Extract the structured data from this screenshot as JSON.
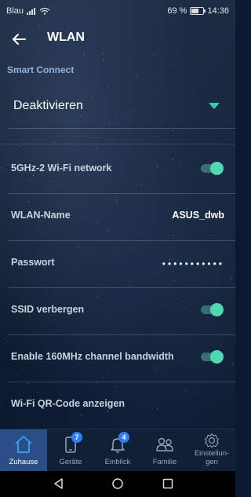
{
  "status_bar": {
    "carrier": "Blau",
    "battery": "69 %",
    "time": "14:36"
  },
  "header": {
    "title": "WLAN"
  },
  "section": {
    "label": "Smart Connect"
  },
  "smart_connect": {
    "selected": "Deaktivieren"
  },
  "rows": [
    {
      "label": "5GHz-2 Wi-Fi network",
      "type": "toggle",
      "enabled": true
    },
    {
      "label": "WLAN-Name",
      "type": "value",
      "value": "ASUS_dwb"
    },
    {
      "label": "Passwort",
      "type": "password",
      "value": "•••••••••••"
    },
    {
      "label": "SSID verbergen",
      "type": "toggle",
      "enabled": true
    },
    {
      "label": "Enable 160MHz channel bandwidth",
      "type": "toggle",
      "enabled": true
    },
    {
      "label": "Wi-Fi QR-Code anzeigen",
      "type": "link"
    }
  ],
  "tabs": [
    {
      "label": "Zuhause",
      "active": true
    },
    {
      "label": "Geräte",
      "badge": "7"
    },
    {
      "label": "Einblick",
      "badge": "4"
    },
    {
      "label": "Familie"
    },
    {
      "label": "Einstellun-",
      "label2": "gen"
    }
  ],
  "colors": {
    "accent": "#2fd3a6",
    "toggle_knob": "#4fd9b0",
    "active_tab": "#2a4f86",
    "badge": "#2e7ef7",
    "section_label": "#8fb4dc"
  }
}
